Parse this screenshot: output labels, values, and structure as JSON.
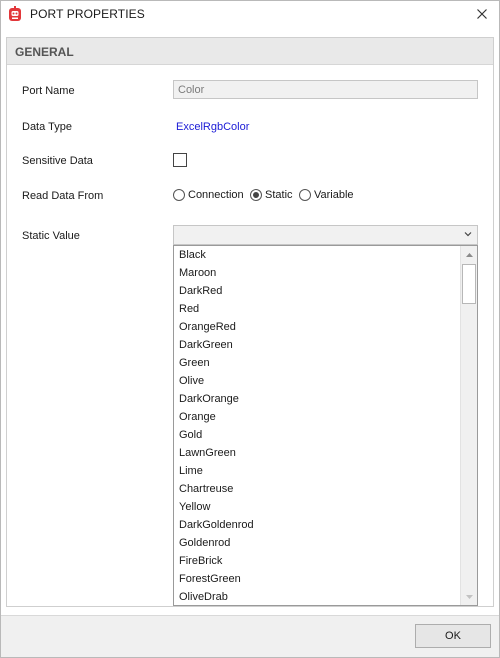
{
  "window": {
    "title": "PORT PROPERTIES",
    "app_icon": "robot-app-icon",
    "close_icon": "close-icon"
  },
  "section": {
    "header": "GENERAL"
  },
  "fields": {
    "port_name_label": "Port Name",
    "port_name_value": "Color",
    "data_type_label": "Data Type",
    "data_type_value": "ExcelRgbColor",
    "sensitive_label": "Sensitive Data",
    "sensitive_checked": false,
    "read_from_label": "Read Data From",
    "read_from_options": [
      "Connection",
      "Static",
      "Variable"
    ],
    "read_from_selected": "Static",
    "static_value_label": "Static Value",
    "static_value": ""
  },
  "dropdown": {
    "items": [
      "Black",
      "Maroon",
      "DarkRed",
      "Red",
      "OrangeRed",
      "DarkGreen",
      "Green",
      "Olive",
      "DarkOrange",
      "Orange",
      "Gold",
      "LawnGreen",
      "Lime",
      "Chartreuse",
      "Yellow",
      "DarkGoldenrod",
      "Goldenrod",
      "FireBrick",
      "ForestGreen",
      "OliveDrab"
    ]
  },
  "footer": {
    "ok_label": "OK"
  },
  "colors": {
    "link_blue": "#1b1bd6",
    "app_icon_red": "#e2373a",
    "header_bg": "#e9e9e9"
  }
}
